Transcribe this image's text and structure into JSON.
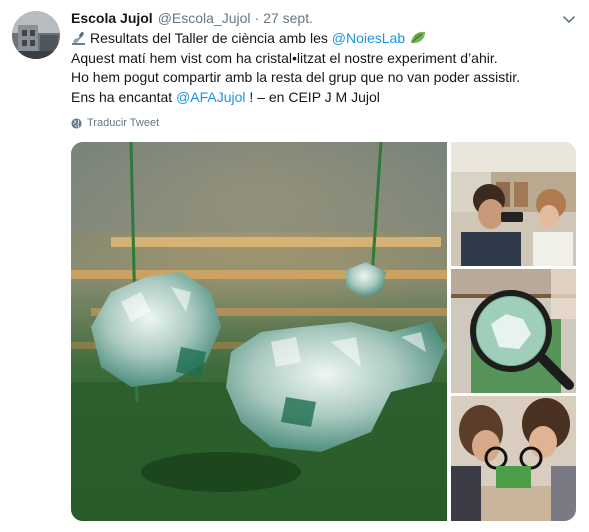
{
  "tweet": {
    "author_name": "Escola Jujol",
    "author_handle": "@Escola_Jujol",
    "separator": "·",
    "timestamp": "27 sept.",
    "lines": [
      {
        "icon": "microscope-icon",
        "pre": "Resultats del Taller de ciència amb les ",
        "link": "@NoiesLab",
        "post": "",
        "after_icon": "leaf-icon"
      },
      {
        "text": "Aquest matí hem vist com ha cristal•litzat el nostre experiment d’ahir."
      },
      {
        "text": "Ho hem pogut compartir amb la resta del grup que no van poder assistir."
      },
      {
        "pre": "Ens ha encantat ",
        "link": "@AFAJujol",
        "post": " ! – en CEIP J M Jujol"
      }
    ],
    "translate_label": "Traducir Tweet",
    "media": [
      {
        "name": "crystal-photo",
        "icon": "image"
      },
      {
        "name": "students-microscope-photo",
        "icon": "image"
      },
      {
        "name": "magnifier-crystal-photo",
        "icon": "image"
      },
      {
        "name": "students-magnifier-photo",
        "icon": "image"
      }
    ]
  },
  "colors": {
    "link": "#1b95e0",
    "secondary_text": "#657786",
    "primary_text": "#14171a"
  },
  "icons": {
    "caret": "chevron-down-icon",
    "globe": "globe-icon"
  }
}
